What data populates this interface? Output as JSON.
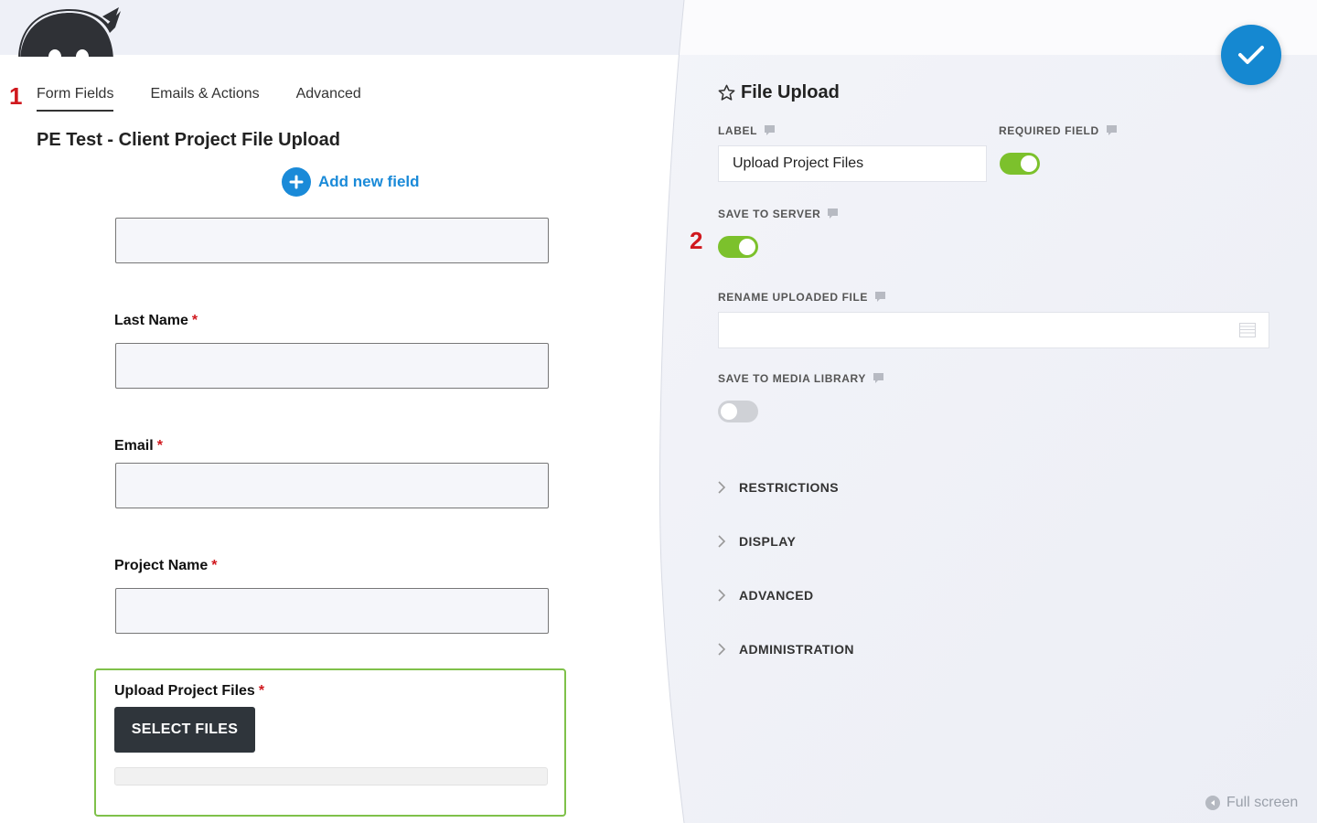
{
  "annotations": {
    "one": "1",
    "two": "2"
  },
  "tabs": [
    {
      "label": "Form Fields",
      "active": true
    },
    {
      "label": "Emails & Actions",
      "active": false
    },
    {
      "label": "Advanced",
      "active": false
    }
  ],
  "form": {
    "title": "PE Test - Client Project File Upload",
    "add_field_label": "Add new field",
    "fields": [
      {
        "label": "Last Name",
        "required_mark": "*"
      },
      {
        "label": "Email",
        "required_mark": "*"
      },
      {
        "label": "Project Name",
        "required_mark": "*"
      }
    ],
    "upload_field": {
      "label": "Upload Project Files",
      "required_mark": "*",
      "button_label": "SELECT FILES",
      "progress": 0
    }
  },
  "panel": {
    "title": "File Upload",
    "label_setting": {
      "label": "LABEL",
      "value": "Upload Project Files"
    },
    "required_setting": {
      "label": "REQUIRED FIELD",
      "on": true
    },
    "save_to_server": {
      "label": "SAVE TO SERVER",
      "on": true
    },
    "rename_uploaded_file": {
      "label": "RENAME UPLOADED FILE",
      "value": ""
    },
    "save_to_media_library": {
      "label": "SAVE TO MEDIA LIBRARY",
      "on": false
    },
    "sections": [
      "RESTRICTIONS",
      "DISPLAY",
      "ADVANCED",
      "ADMINISTRATION"
    ],
    "fullscreen_label": "Full screen"
  },
  "colors": {
    "accent_blue": "#1a8ad8",
    "toggle_on": "#7cc12c",
    "required_red": "#d0181e",
    "focus_green": "#7fc14a"
  },
  "icons": [
    "ninja-logo-icon",
    "plus-icon",
    "star-icon",
    "comment-icon",
    "merge-tags-icon",
    "chevron-right-icon",
    "checkmark-icon",
    "arrow-left-circle-icon"
  ]
}
